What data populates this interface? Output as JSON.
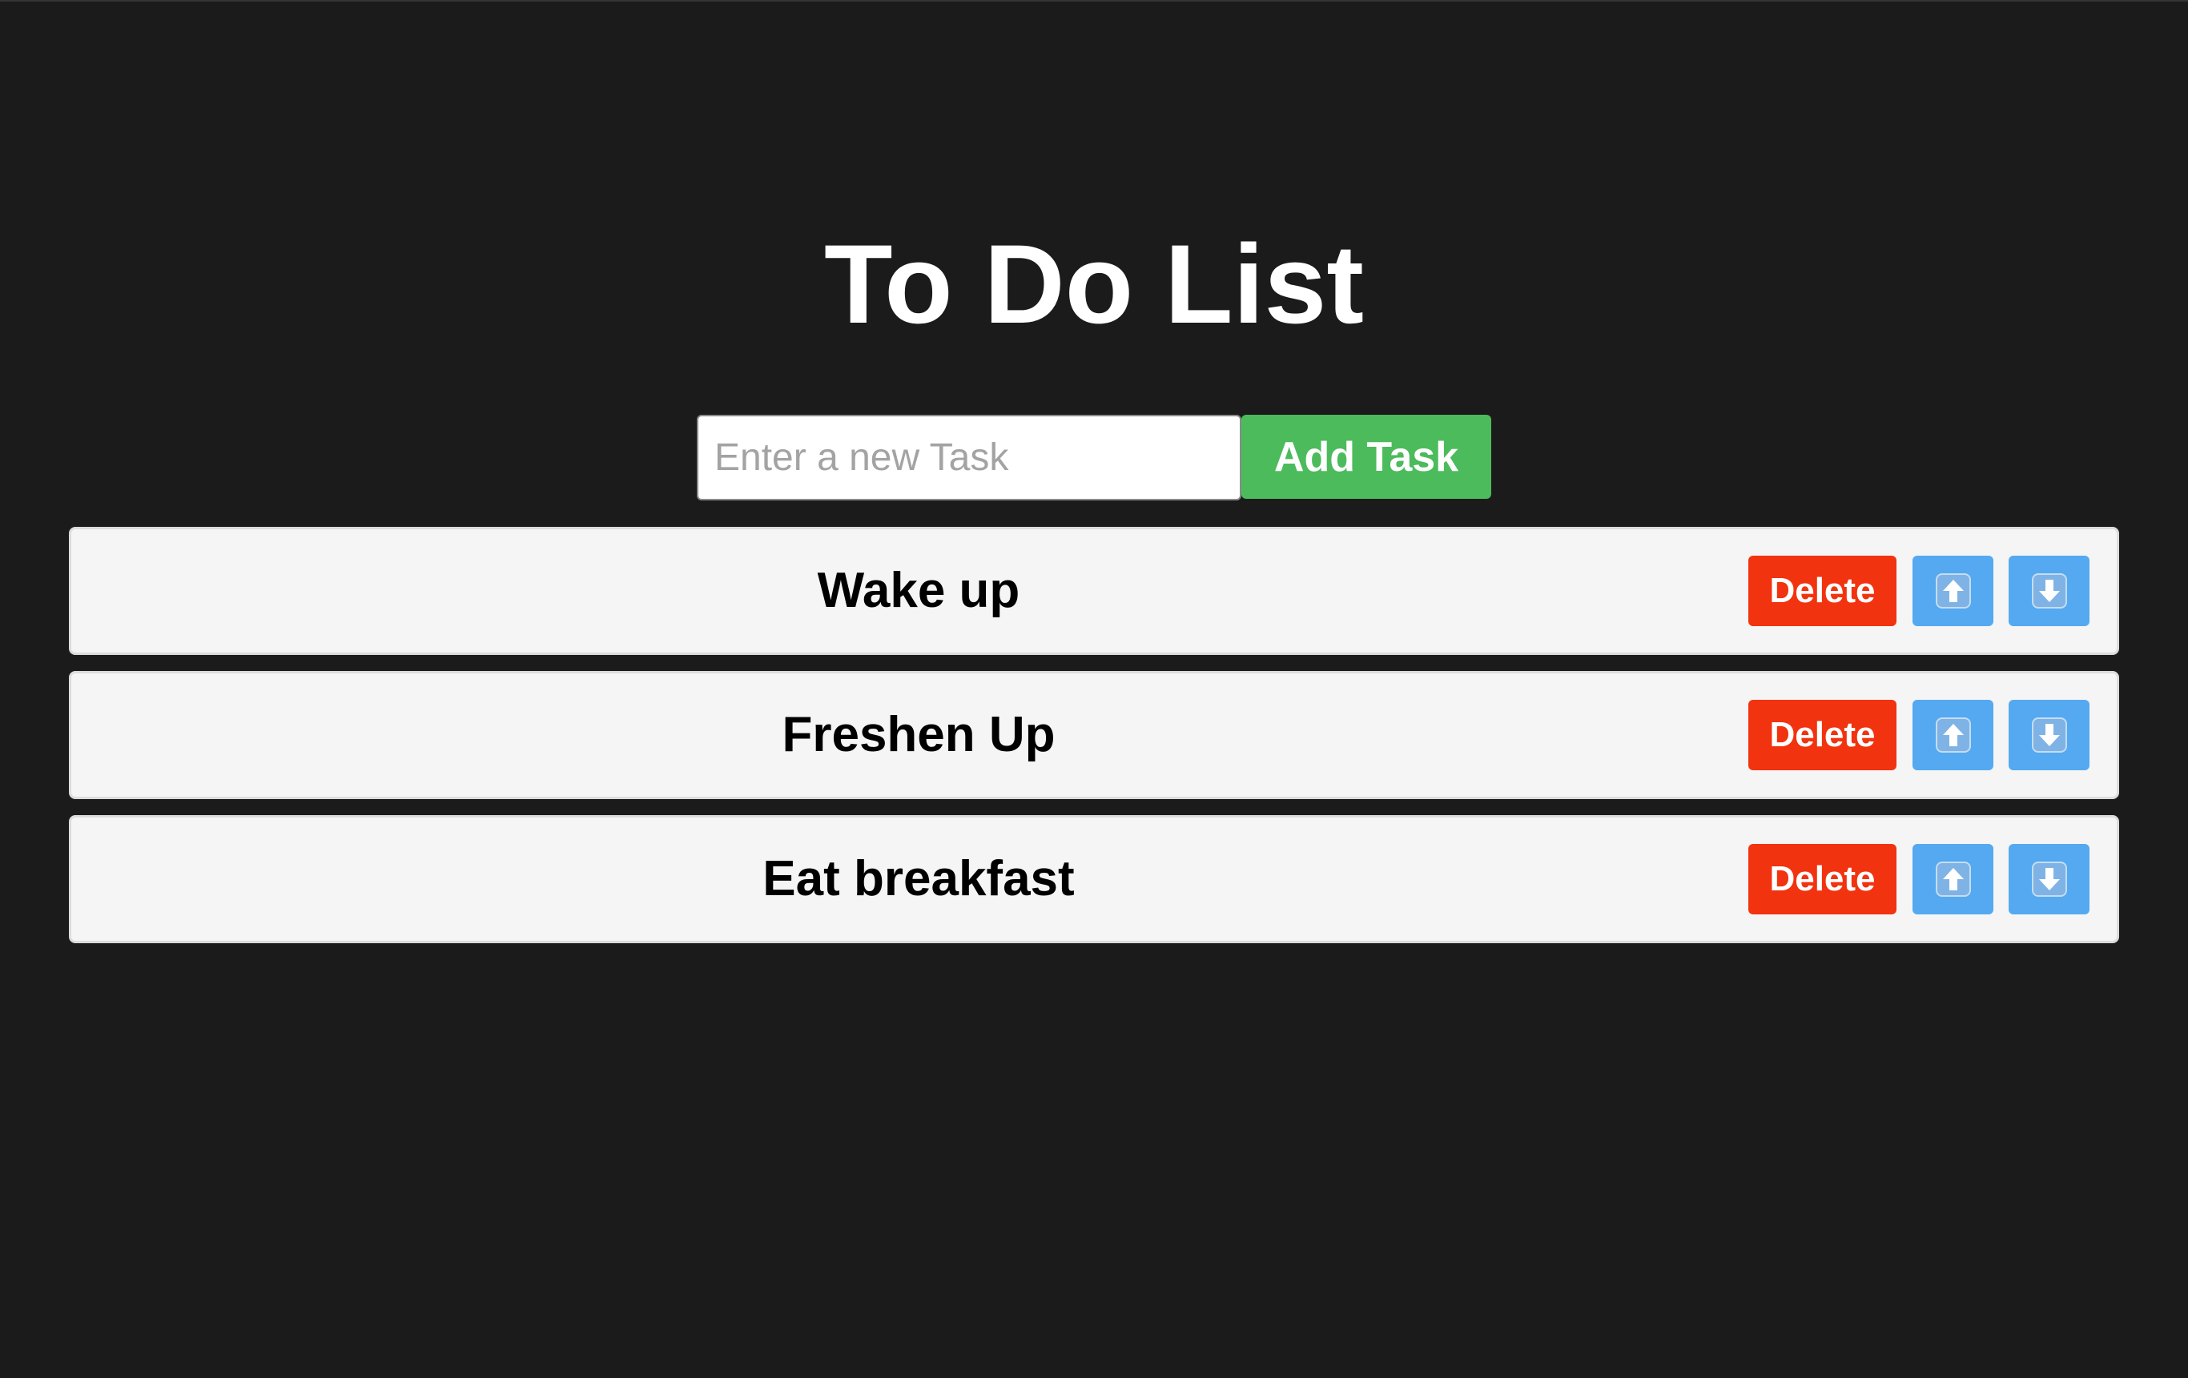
{
  "title": "To Do List",
  "input": {
    "placeholder": "Enter a new Task",
    "value": ""
  },
  "add_button_label": "Add Task",
  "tasks": [
    {
      "text": "Wake up",
      "delete_label": "Delete",
      "up_icon": "arrow-up-icon",
      "down_icon": "arrow-down-icon"
    },
    {
      "text": "Freshen Up",
      "delete_label": "Delete",
      "up_icon": "arrow-up-icon",
      "down_icon": "arrow-down-icon"
    },
    {
      "text": "Eat breakfast",
      "delete_label": "Delete",
      "up_icon": "arrow-up-icon",
      "down_icon": "arrow-down-icon"
    }
  ],
  "colors": {
    "background": "#1b1b1b",
    "add_button": "#4cbb5c",
    "delete_button": "#f1330f",
    "move_button": "#54a9f0",
    "task_background": "#f5f5f5"
  }
}
